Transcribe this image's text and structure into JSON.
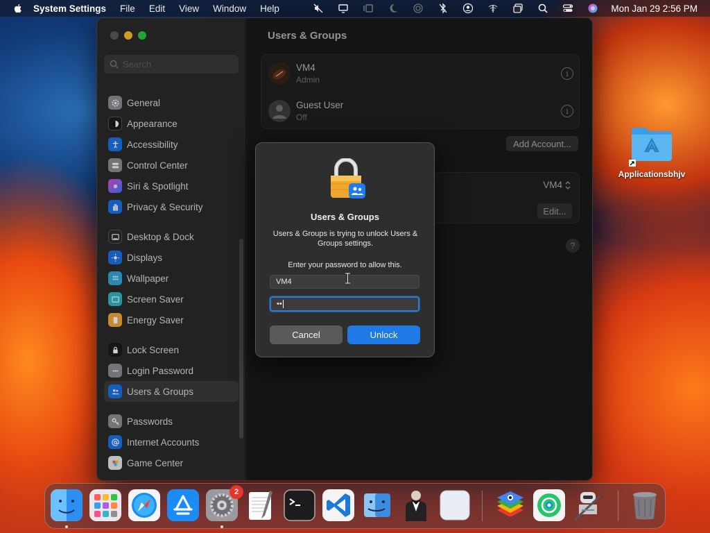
{
  "menubar": {
    "app_name": "System Settings",
    "menus": [
      "File",
      "Edit",
      "View",
      "Window",
      "Help"
    ],
    "clock": "Mon Jan 29  2:56 PM"
  },
  "sidebar": {
    "search_placeholder": "Search",
    "items": [
      {
        "label": "General",
        "icon": "gear-icon",
        "color": "#8e8e93"
      },
      {
        "label": "Appearance",
        "icon": "appearance-icon",
        "color": "#1c1c1e"
      },
      {
        "label": "Accessibility",
        "icon": "accessibility-icon",
        "color": "#1a73e8"
      },
      {
        "label": "Control Center",
        "icon": "control-center-icon",
        "color": "#8e8e93"
      },
      {
        "label": "Siri & Spotlight",
        "icon": "siri-icon",
        "color": "#7b3fe4"
      },
      {
        "label": "Privacy & Security",
        "icon": "hand-icon",
        "color": "#1a73e8"
      },
      {
        "label": "Desktop & Dock",
        "icon": "dock-icon",
        "color": "#2c2c2e"
      },
      {
        "label": "Displays",
        "icon": "displays-icon",
        "color": "#1a73e8"
      },
      {
        "label": "Wallpaper",
        "icon": "wallpaper-icon",
        "color": "#35a8d8"
      },
      {
        "label": "Screen Saver",
        "icon": "screensaver-icon",
        "color": "#35b5c8"
      },
      {
        "label": "Energy Saver",
        "icon": "battery-icon",
        "color": "#f2a93b"
      },
      {
        "label": "Lock Screen",
        "icon": "lock-icon",
        "color": "#1c1c1e"
      },
      {
        "label": "Login Password",
        "icon": "password-icon",
        "color": "#8e8e93"
      },
      {
        "label": "Users & Groups",
        "icon": "users-icon",
        "color": "#1a73e8"
      },
      {
        "label": "Passwords",
        "icon": "key-icon",
        "color": "#8e8e93"
      },
      {
        "label": "Internet Accounts",
        "icon": "at-icon",
        "color": "#1a73e8"
      },
      {
        "label": "Game Center",
        "icon": "game-center-icon",
        "color": "#e8e8e8"
      }
    ],
    "selected": "Users & Groups"
  },
  "content": {
    "title": "Users & Groups",
    "users": [
      {
        "name": "VM4",
        "role": "Admin"
      },
      {
        "name": "Guest User",
        "role": "Off"
      }
    ],
    "add_account_label": "Add Account...",
    "auto_login_value": "VM4",
    "edit_label": "Edit...",
    "help_label": "?"
  },
  "dialog": {
    "title": "Users & Groups",
    "message": "Users & Groups is trying to unlock Users & Groups settings.",
    "prompt": "Enter your password to allow this.",
    "username_value": "VM4",
    "password_mask": "••",
    "cancel_label": "Cancel",
    "unlock_label": "Unlock"
  },
  "desktop": {
    "folder_label": "Applicationsbhjv"
  },
  "dock": {
    "apps": [
      {
        "name": "Finder",
        "icon": "finder-icon"
      },
      {
        "name": "Launchpad",
        "icon": "launchpad-icon"
      },
      {
        "name": "Safari",
        "icon": "safari-icon"
      },
      {
        "name": "App Store",
        "icon": "app-store-icon"
      },
      {
        "name": "System Settings",
        "icon": "system-settings-icon",
        "badge": "2"
      },
      {
        "name": "TextEdit",
        "icon": "textedit-icon"
      },
      {
        "name": "Terminal",
        "icon": "terminal-icon"
      },
      {
        "name": "Visual Studio Code",
        "icon": "vscode-icon"
      },
      {
        "name": "Migration Assistant",
        "icon": "migration-icon"
      },
      {
        "name": "Bartender",
        "icon": "bartender-icon"
      },
      {
        "name": "Blank App",
        "icon": "blank-app-icon"
      },
      {
        "name": "BlueStacks",
        "icon": "bluestacks-icon"
      },
      {
        "name": "Find My",
        "icon": "findmy-icon"
      },
      {
        "name": "Automator",
        "icon": "automator-icon"
      },
      {
        "name": "Trash",
        "icon": "trash-icon"
      }
    ]
  }
}
